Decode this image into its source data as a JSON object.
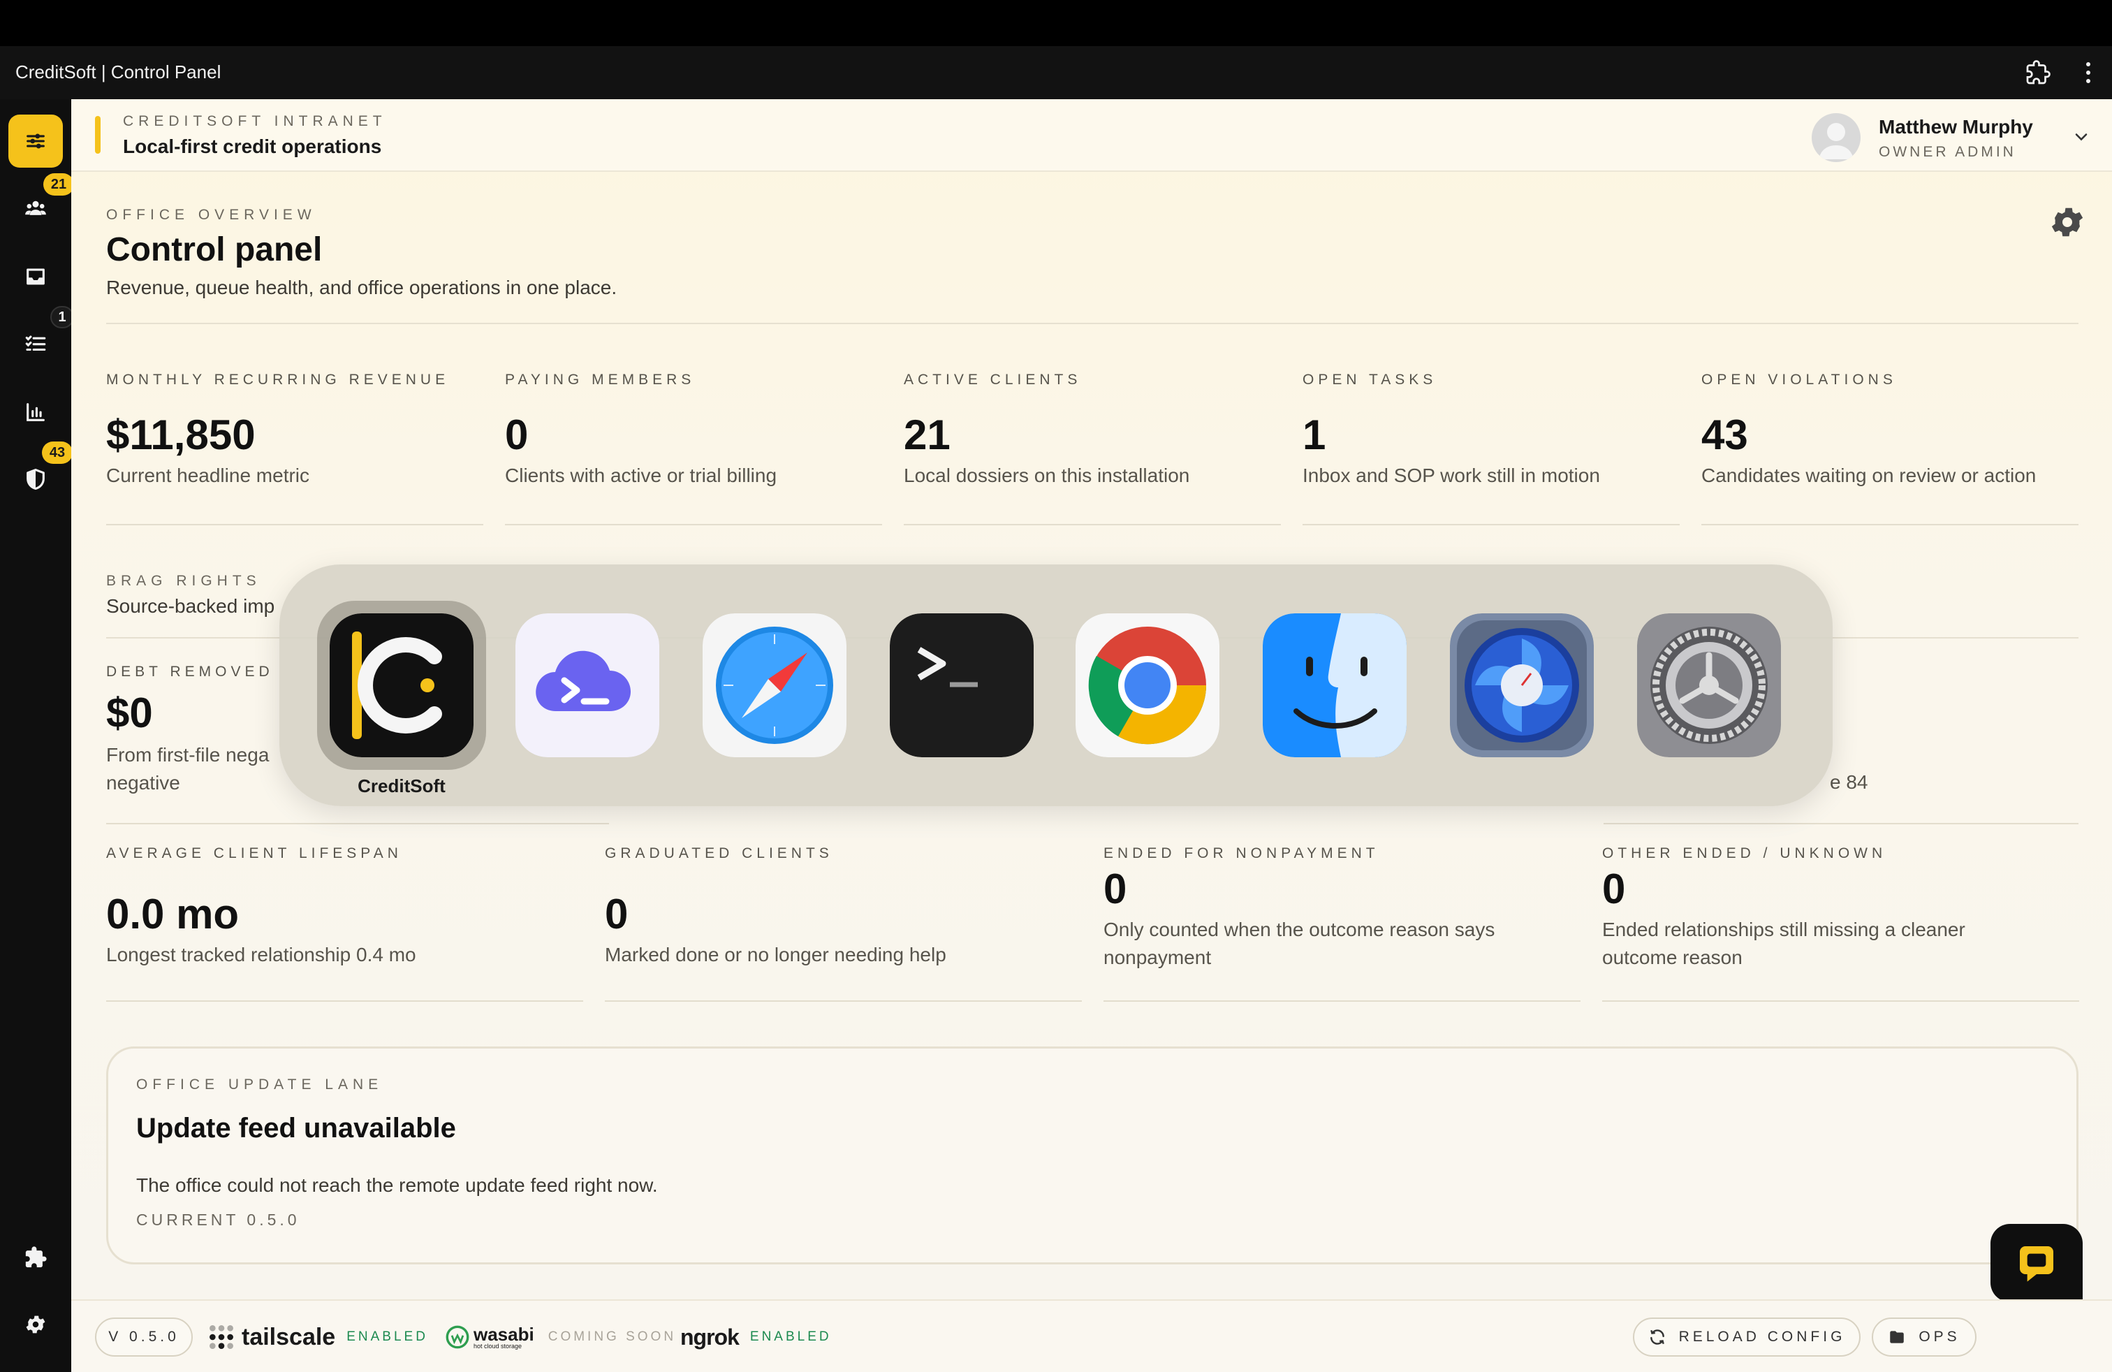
{
  "window": {
    "title": "CreditSoft | Control Panel"
  },
  "sidebar": {
    "badges": {
      "clients": "21",
      "tasks": "1",
      "violations": "43"
    }
  },
  "header": {
    "eyebrow": "CREDITSOFT INTRANET",
    "subtitle": "Local-first credit operations",
    "user": {
      "name": "Matthew Murphy",
      "role": "OWNER ADMIN"
    }
  },
  "overview": {
    "eyebrow": "OFFICE OVERVIEW",
    "title": "Control panel",
    "description": "Revenue, queue health, and office operations in one place."
  },
  "stats": [
    {
      "label": "MONTHLY RECURRING REVENUE",
      "value": "$11,850",
      "desc": "Current headline metric"
    },
    {
      "label": "PAYING MEMBERS",
      "value": "0",
      "desc": "Clients with active or trial billing"
    },
    {
      "label": "ACTIVE CLIENTS",
      "value": "21",
      "desc": "Local dossiers on this installation"
    },
    {
      "label": "OPEN TASKS",
      "value": "1",
      "desc": "Inbox and SOP work still in motion"
    },
    {
      "label": "OPEN VIOLATIONS",
      "value": "43",
      "desc": "Candidates waiting on review or action"
    }
  ],
  "brag": {
    "eyebrow": "BRAG RIGHTS",
    "subtitle": "Source-backed imp"
  },
  "debt": {
    "label": "DEBT REMOVED",
    "value": "$0",
    "desc_line1": "From first-file nega",
    "desc_line2": "negative",
    "partial_right": "e 84"
  },
  "lifespan_stats": [
    {
      "label": "AVERAGE CLIENT LIFESPAN",
      "value": "0.0 mo",
      "desc": "Longest tracked relationship 0.4 mo"
    },
    {
      "label": "GRADUATED CLIENTS",
      "value": "0",
      "desc": "Marked done or no longer needing help"
    },
    {
      "label": "ENDED FOR NONPAYMENT",
      "value": "0",
      "desc": "Only counted when the outcome reason says nonpayment"
    },
    {
      "label": "OTHER ENDED / UNKNOWN",
      "value": "0",
      "desc": "Ended relationships still missing a cleaner outcome reason"
    }
  ],
  "update": {
    "eyebrow": "OFFICE UPDATE LANE",
    "title": "Update feed unavailable",
    "description": "The office could not reach the remote update feed right now.",
    "current": "CURRENT 0.5.0"
  },
  "footer": {
    "version": "V 0.5.0",
    "services": [
      {
        "name": "tailscale",
        "status": "ENABLED"
      },
      {
        "name": "wasabi",
        "tagline": "hot cloud storage",
        "status": "COMING SOON"
      },
      {
        "name": "ngrok",
        "status": "ENABLED"
      }
    ],
    "reload_label": "RELOAD CONFIG",
    "ops_label": "OPS"
  },
  "switcher": {
    "apps": [
      "CreditSoft",
      "Terminal Cloud",
      "Safari",
      "Terminal",
      "Chrome",
      "Finder",
      "Fan Control",
      "System Settings"
    ],
    "selected_label": "CreditSoft"
  },
  "colors": {
    "accent": "#f5c21b",
    "sidebar": "#0f0f0f",
    "status_enabled": "#1c8a4f",
    "status_soon": "#a8a399"
  }
}
